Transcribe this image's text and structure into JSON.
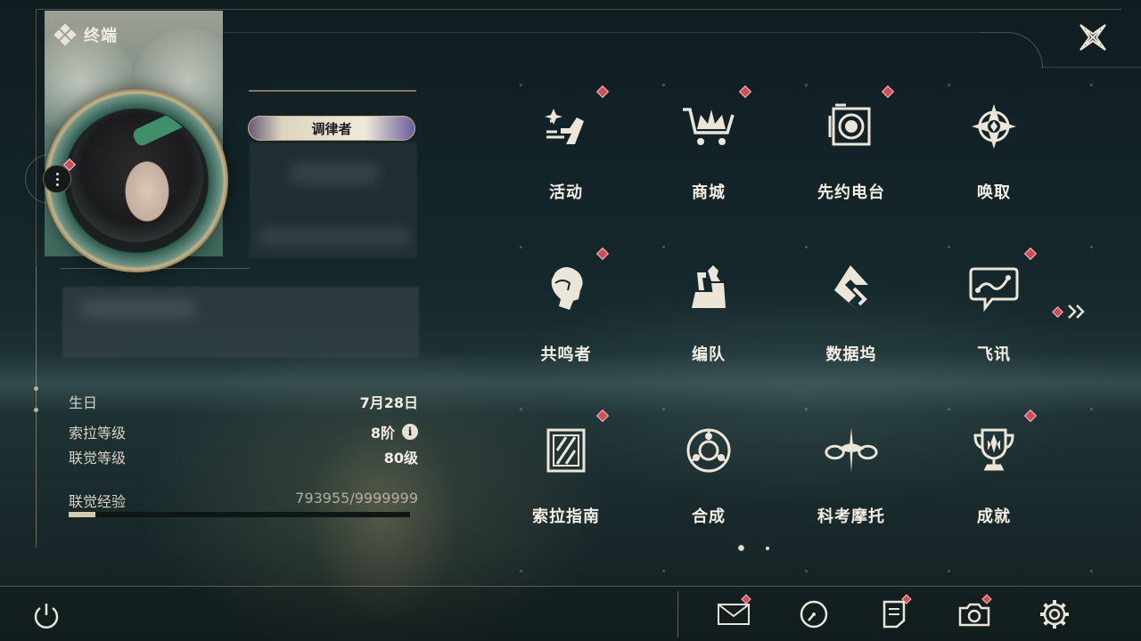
{
  "header": {
    "title": "终端"
  },
  "profile": {
    "title_badge": "调律者",
    "stats": [
      {
        "label": "生日",
        "value": "7月28日"
      },
      {
        "label": "索拉等级",
        "value": "8阶",
        "info": true
      },
      {
        "label": "联觉等级",
        "value": "80级"
      }
    ],
    "exp": {
      "label": "联觉经验",
      "value": "793955/9999999",
      "progress": 0.079
    }
  },
  "menu": {
    "items": [
      {
        "label": "活动",
        "icon": "activity-icon",
        "badge": true
      },
      {
        "label": "商城",
        "icon": "shop-cart-icon",
        "badge": true
      },
      {
        "label": "先约电台",
        "icon": "radio-icon",
        "badge": true
      },
      {
        "label": "唤取",
        "icon": "convene-compass-icon",
        "badge": false
      },
      {
        "label": "共鸣者",
        "icon": "resonator-head-icon",
        "badge": true
      },
      {
        "label": "编队",
        "icon": "chess-team-icon",
        "badge": false
      },
      {
        "label": "数据坞",
        "icon": "data-dock-icon",
        "badge": false
      },
      {
        "label": "飞讯",
        "icon": "chat-message-icon",
        "badge": true
      },
      {
        "label": "索拉指南",
        "icon": "guidebook-icon",
        "badge": true
      },
      {
        "label": "合成",
        "icon": "synthesis-icon",
        "badge": false
      },
      {
        "label": "科考摩托",
        "icon": "motorcycle-icon",
        "badge": false
      },
      {
        "label": "成就",
        "icon": "trophy-icon",
        "badge": true
      }
    ],
    "pages": 2,
    "current_page": 1
  },
  "bottom": {
    "buttons": [
      {
        "name": "mail-icon",
        "badge": true
      },
      {
        "name": "clock-icon",
        "badge": false
      },
      {
        "name": "notes-icon",
        "badge": true
      },
      {
        "name": "camera-icon",
        "badge": true
      },
      {
        "name": "settings-gear-icon",
        "badge": false
      }
    ]
  },
  "colors": {
    "badge": "#d64a55",
    "accent": "#d8c9a8",
    "text": "#f3efe4"
  }
}
